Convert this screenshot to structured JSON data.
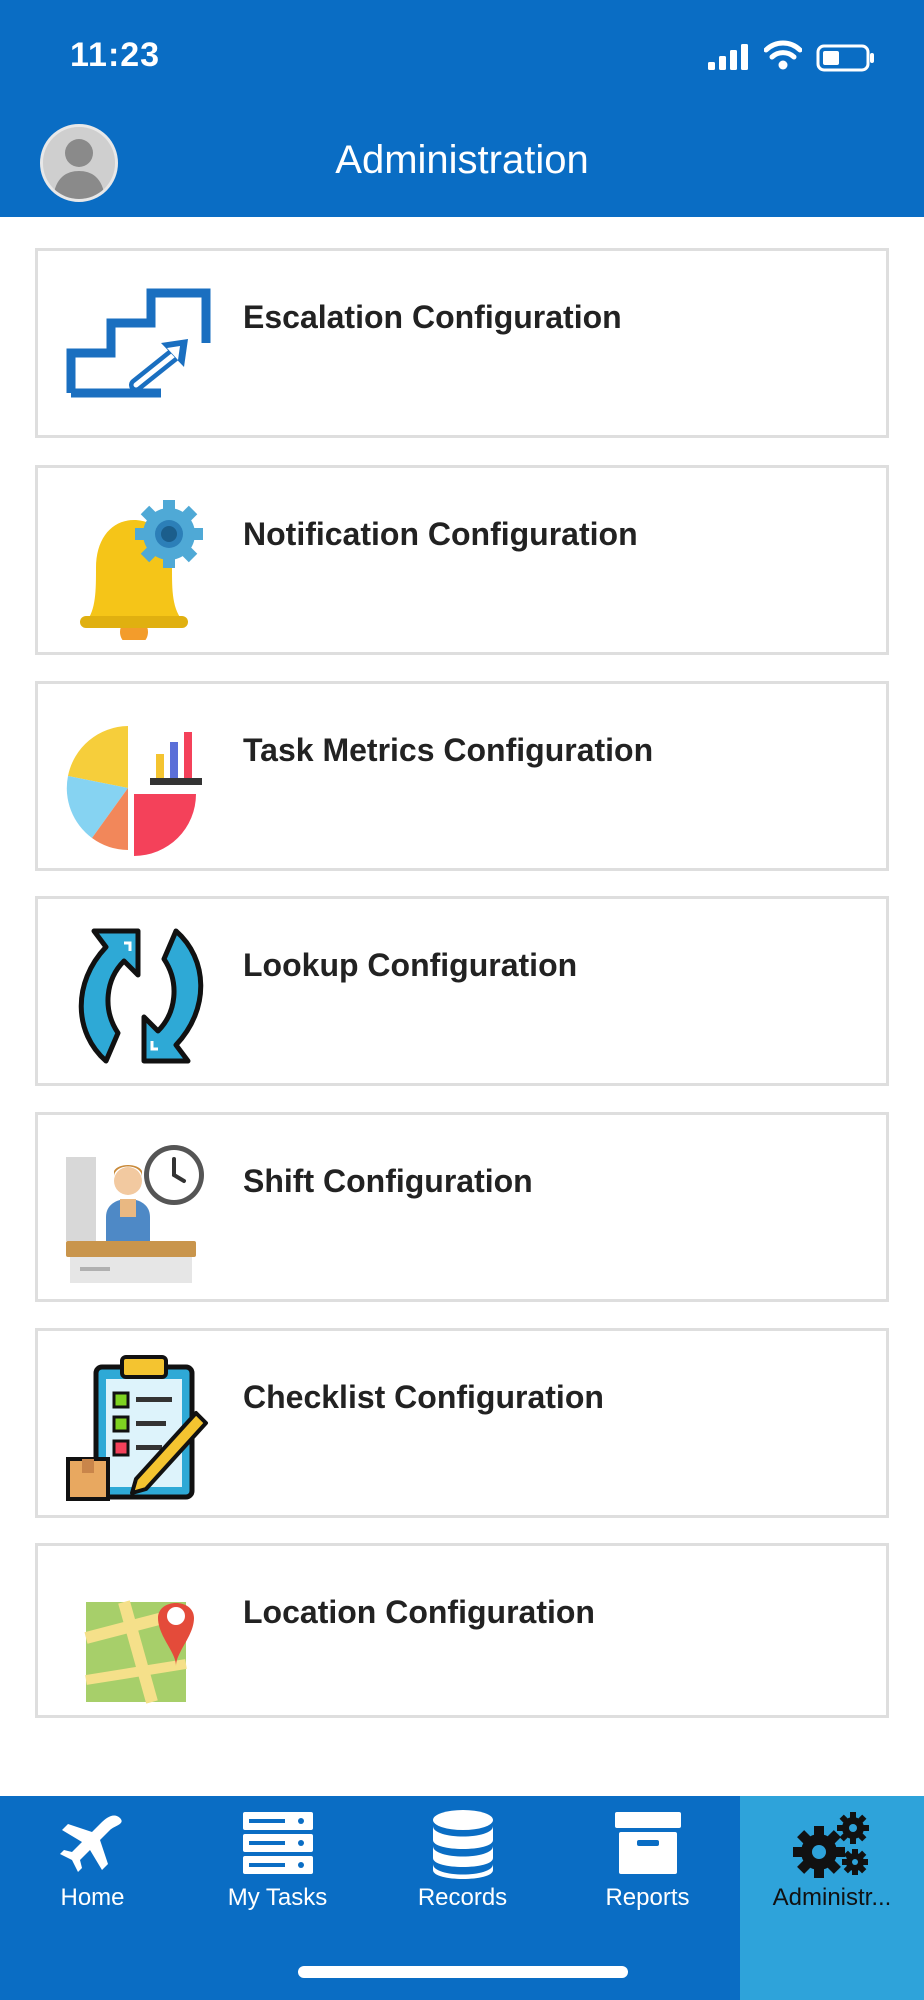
{
  "status_bar": {
    "time": "11:23"
  },
  "header": {
    "title": "Administration"
  },
  "menu": {
    "items": [
      {
        "label": "Escalation Configuration",
        "icon": "escalation-stairs-icon"
      },
      {
        "label": "Notification Configuration",
        "icon": "bell-gear-icon"
      },
      {
        "label": "Task Metrics Configuration",
        "icon": "pie-chart-icon"
      },
      {
        "label": "Lookup Configuration",
        "icon": "refresh-arrows-icon"
      },
      {
        "label": "Shift Configuration",
        "icon": "worker-clock-icon"
      },
      {
        "label": "Checklist Configuration",
        "icon": "clipboard-checklist-icon"
      },
      {
        "label": "Location Configuration",
        "icon": "map-pin-icon"
      }
    ]
  },
  "tabbar": {
    "tabs": [
      {
        "label": "Home",
        "icon": "airplane-icon"
      },
      {
        "label": "My Tasks",
        "icon": "server-stack-icon"
      },
      {
        "label": "Records",
        "icon": "database-icon"
      },
      {
        "label": "Reports",
        "icon": "archive-box-icon"
      },
      {
        "label": "Administr...",
        "icon": "gears-icon"
      }
    ],
    "active_index": 4
  },
  "colors": {
    "primary": "#0A6DC4",
    "active_tab": "#2EA3DA"
  }
}
